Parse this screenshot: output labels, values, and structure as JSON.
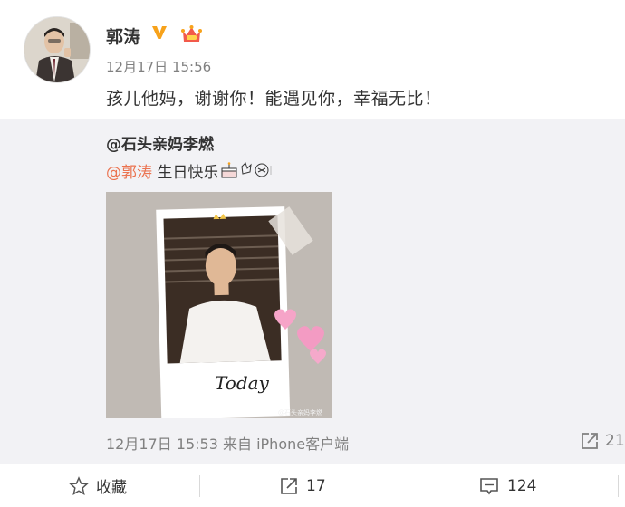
{
  "post": {
    "author": "郭涛",
    "timestamp": "12月17日 15:56",
    "text": "孩儿他妈，谢谢你！能遇见你，幸福无比！"
  },
  "repost": {
    "author": "@石头亲妈李燃",
    "mention": "@郭涛",
    "text": " 生日快乐",
    "timestamp": "12月17日 15:53 来自 iPhone客户端",
    "repost_count": "21",
    "photo_caption": "Today",
    "photo_watermark": "@石头亲妈李燃"
  },
  "actions": {
    "favorite_label": "收藏",
    "repost_count": "17",
    "comment_count": "124"
  },
  "colors": {
    "mention": "#eb7350",
    "verified": "#f7a21b",
    "repost_bg": "#f2f2f5",
    "muted": "#808080"
  },
  "icons": [
    "verified-icon",
    "vip-crown-icon",
    "cake-icon",
    "repost-icon",
    "star-icon",
    "comment-icon"
  ]
}
